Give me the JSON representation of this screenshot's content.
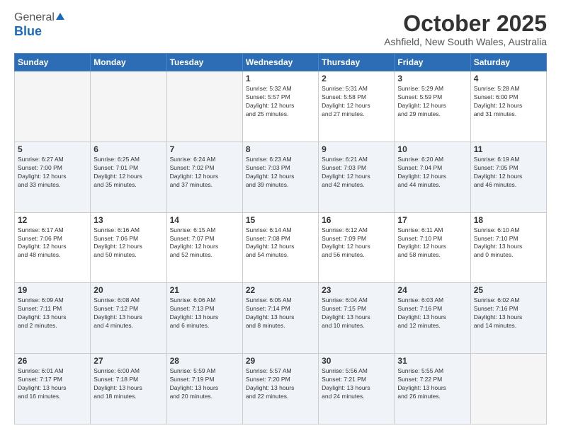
{
  "header": {
    "logo": {
      "line1": "General",
      "line2": "Blue"
    },
    "title": "October 2025",
    "subtitle": "Ashfield, New South Wales, Australia"
  },
  "days_of_week": [
    "Sunday",
    "Monday",
    "Tuesday",
    "Wednesday",
    "Thursday",
    "Friday",
    "Saturday"
  ],
  "weeks": [
    [
      {
        "day": "",
        "info": ""
      },
      {
        "day": "",
        "info": ""
      },
      {
        "day": "",
        "info": ""
      },
      {
        "day": "1",
        "info": "Sunrise: 5:32 AM\nSunset: 5:57 PM\nDaylight: 12 hours\nand 25 minutes."
      },
      {
        "day": "2",
        "info": "Sunrise: 5:31 AM\nSunset: 5:58 PM\nDaylight: 12 hours\nand 27 minutes."
      },
      {
        "day": "3",
        "info": "Sunrise: 5:29 AM\nSunset: 5:59 PM\nDaylight: 12 hours\nand 29 minutes."
      },
      {
        "day": "4",
        "info": "Sunrise: 5:28 AM\nSunset: 6:00 PM\nDaylight: 12 hours\nand 31 minutes."
      }
    ],
    [
      {
        "day": "5",
        "info": "Sunrise: 6:27 AM\nSunset: 7:00 PM\nDaylight: 12 hours\nand 33 minutes."
      },
      {
        "day": "6",
        "info": "Sunrise: 6:25 AM\nSunset: 7:01 PM\nDaylight: 12 hours\nand 35 minutes."
      },
      {
        "day": "7",
        "info": "Sunrise: 6:24 AM\nSunset: 7:02 PM\nDaylight: 12 hours\nand 37 minutes."
      },
      {
        "day": "8",
        "info": "Sunrise: 6:23 AM\nSunset: 7:03 PM\nDaylight: 12 hours\nand 39 minutes."
      },
      {
        "day": "9",
        "info": "Sunrise: 6:21 AM\nSunset: 7:03 PM\nDaylight: 12 hours\nand 42 minutes."
      },
      {
        "day": "10",
        "info": "Sunrise: 6:20 AM\nSunset: 7:04 PM\nDaylight: 12 hours\nand 44 minutes."
      },
      {
        "day": "11",
        "info": "Sunrise: 6:19 AM\nSunset: 7:05 PM\nDaylight: 12 hours\nand 46 minutes."
      }
    ],
    [
      {
        "day": "12",
        "info": "Sunrise: 6:17 AM\nSunset: 7:06 PM\nDaylight: 12 hours\nand 48 minutes."
      },
      {
        "day": "13",
        "info": "Sunrise: 6:16 AM\nSunset: 7:06 PM\nDaylight: 12 hours\nand 50 minutes."
      },
      {
        "day": "14",
        "info": "Sunrise: 6:15 AM\nSunset: 7:07 PM\nDaylight: 12 hours\nand 52 minutes."
      },
      {
        "day": "15",
        "info": "Sunrise: 6:14 AM\nSunset: 7:08 PM\nDaylight: 12 hours\nand 54 minutes."
      },
      {
        "day": "16",
        "info": "Sunrise: 6:12 AM\nSunset: 7:09 PM\nDaylight: 12 hours\nand 56 minutes."
      },
      {
        "day": "17",
        "info": "Sunrise: 6:11 AM\nSunset: 7:10 PM\nDaylight: 12 hours\nand 58 minutes."
      },
      {
        "day": "18",
        "info": "Sunrise: 6:10 AM\nSunset: 7:10 PM\nDaylight: 13 hours\nand 0 minutes."
      }
    ],
    [
      {
        "day": "19",
        "info": "Sunrise: 6:09 AM\nSunset: 7:11 PM\nDaylight: 13 hours\nand 2 minutes."
      },
      {
        "day": "20",
        "info": "Sunrise: 6:08 AM\nSunset: 7:12 PM\nDaylight: 13 hours\nand 4 minutes."
      },
      {
        "day": "21",
        "info": "Sunrise: 6:06 AM\nSunset: 7:13 PM\nDaylight: 13 hours\nand 6 minutes."
      },
      {
        "day": "22",
        "info": "Sunrise: 6:05 AM\nSunset: 7:14 PM\nDaylight: 13 hours\nand 8 minutes."
      },
      {
        "day": "23",
        "info": "Sunrise: 6:04 AM\nSunset: 7:15 PM\nDaylight: 13 hours\nand 10 minutes."
      },
      {
        "day": "24",
        "info": "Sunrise: 6:03 AM\nSunset: 7:16 PM\nDaylight: 13 hours\nand 12 minutes."
      },
      {
        "day": "25",
        "info": "Sunrise: 6:02 AM\nSunset: 7:16 PM\nDaylight: 13 hours\nand 14 minutes."
      }
    ],
    [
      {
        "day": "26",
        "info": "Sunrise: 6:01 AM\nSunset: 7:17 PM\nDaylight: 13 hours\nand 16 minutes."
      },
      {
        "day": "27",
        "info": "Sunrise: 6:00 AM\nSunset: 7:18 PM\nDaylight: 13 hours\nand 18 minutes."
      },
      {
        "day": "28",
        "info": "Sunrise: 5:59 AM\nSunset: 7:19 PM\nDaylight: 13 hours\nand 20 minutes."
      },
      {
        "day": "29",
        "info": "Sunrise: 5:57 AM\nSunset: 7:20 PM\nDaylight: 13 hours\nand 22 minutes."
      },
      {
        "day": "30",
        "info": "Sunrise: 5:56 AM\nSunset: 7:21 PM\nDaylight: 13 hours\nand 24 minutes."
      },
      {
        "day": "31",
        "info": "Sunrise: 5:55 AM\nSunset: 7:22 PM\nDaylight: 13 hours\nand 26 minutes."
      },
      {
        "day": "",
        "info": ""
      }
    ]
  ]
}
